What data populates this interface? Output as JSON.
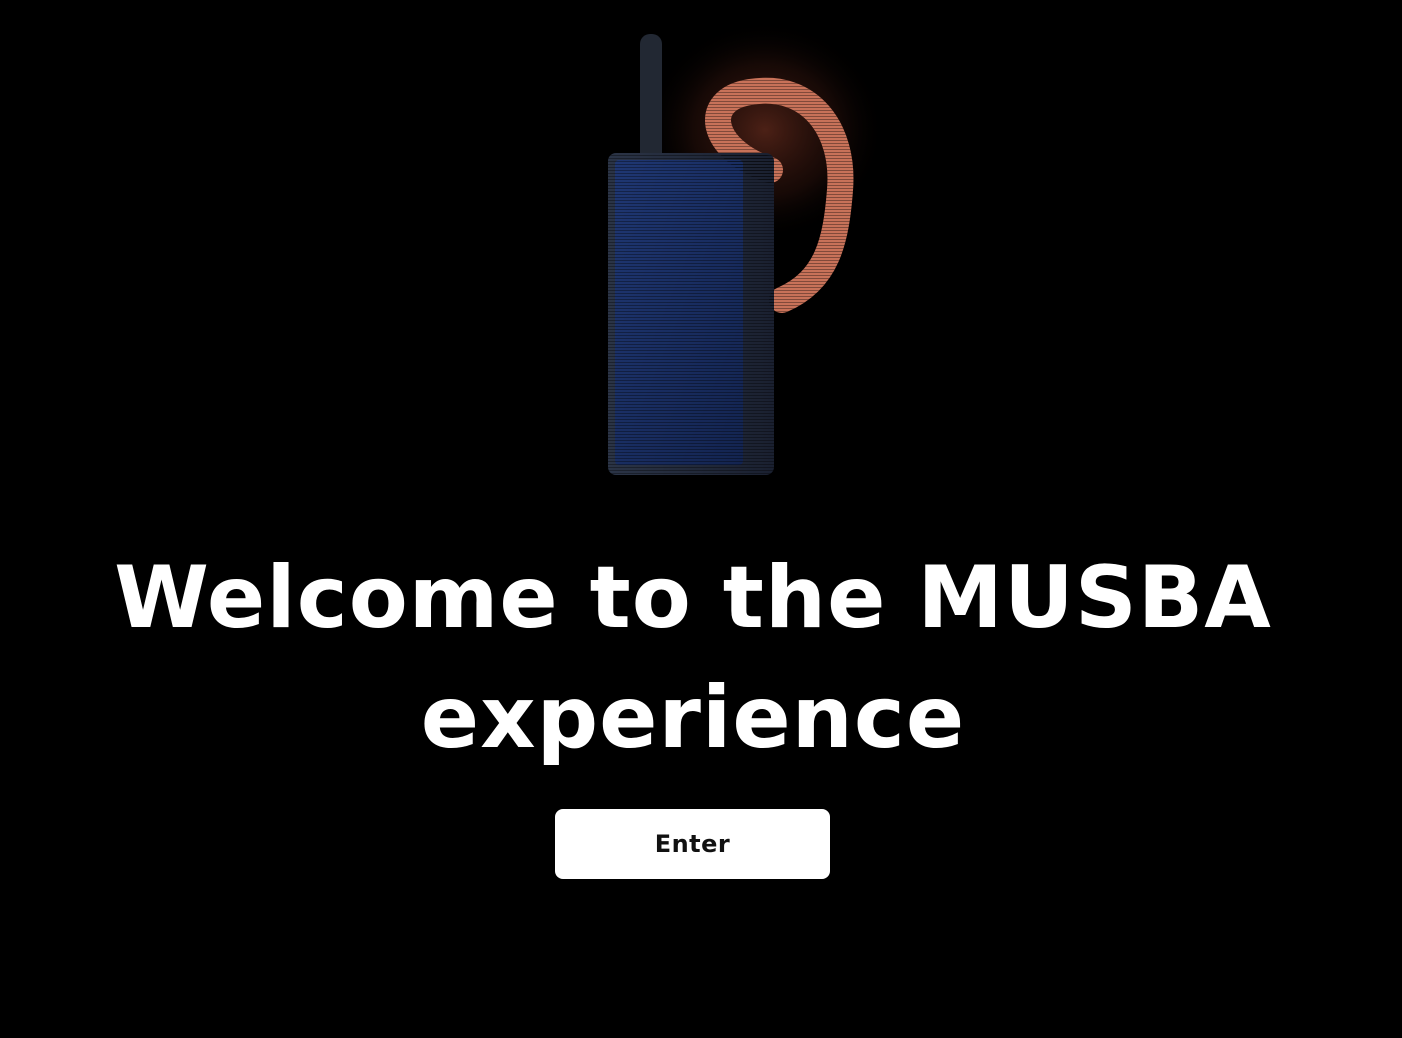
{
  "hero": {
    "headline": "Welcome to the MUSBA experience",
    "enter_label": "Enter"
  },
  "illustration": {
    "icon": "walkie-talkie-with-earpiece-icon",
    "colors": {
      "device_body": "#22304f",
      "device_screen": "#1a2e66",
      "earpiece": "#c87259",
      "glow": "#8a3b28"
    }
  },
  "colors": {
    "background": "#000000",
    "text": "#ffffff",
    "button_bg": "#ffffff",
    "button_text": "#111111"
  }
}
